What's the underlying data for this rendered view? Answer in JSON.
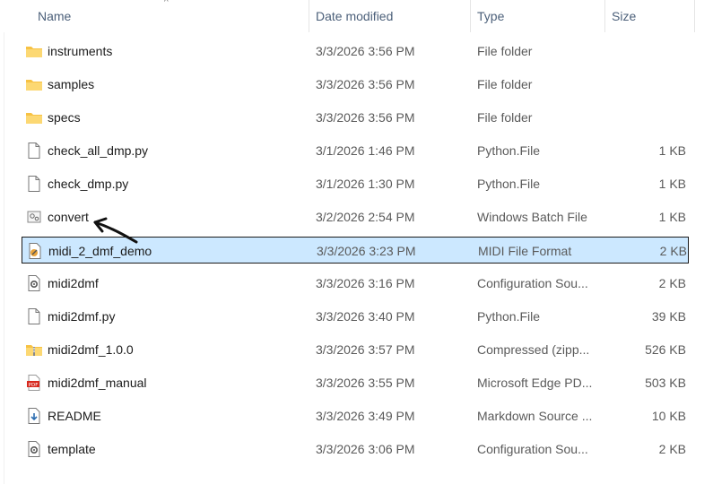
{
  "columns": {
    "name": "Name",
    "date_modified": "Date modified",
    "type": "Type",
    "size": "Size"
  },
  "files": [
    {
      "name": "instruments",
      "date": "3/3/2026 3:56 PM",
      "type": "File folder",
      "size": "",
      "icon": "folder-icon"
    },
    {
      "name": "samples",
      "date": "3/3/2026 3:56 PM",
      "type": "File folder",
      "size": "",
      "icon": "folder-icon"
    },
    {
      "name": "specs",
      "date": "3/3/2026 3:56 PM",
      "type": "File folder",
      "size": "",
      "icon": "folder-icon"
    },
    {
      "name": "check_all_dmp.py",
      "date": "3/1/2026 1:46 PM",
      "type": "Python.File",
      "size": "1 KB",
      "icon": "document-icon"
    },
    {
      "name": "check_dmp.py",
      "date": "3/1/2026 1:30 PM",
      "type": "Python.File",
      "size": "1 KB",
      "icon": "document-icon"
    },
    {
      "name": "convert",
      "date": "3/2/2026 2:54 PM",
      "type": "Windows Batch File",
      "size": "1 KB",
      "icon": "batch-file-icon"
    },
    {
      "name": "midi_2_dmf_demo",
      "date": "3/3/2026 3:23 PM",
      "type": "MIDI File Format",
      "size": "2 KB",
      "icon": "midi-file-icon",
      "selected": true
    },
    {
      "name": "midi2dmf",
      "date": "3/3/2026 3:16 PM",
      "type": "Configuration Sou...",
      "size": "2 KB",
      "icon": "config-file-icon"
    },
    {
      "name": "midi2dmf.py",
      "date": "3/3/2026 3:40 PM",
      "type": "Python.File",
      "size": "39 KB",
      "icon": "document-icon"
    },
    {
      "name": "midi2dmf_1.0.0",
      "date": "3/3/2026 3:57 PM",
      "type": "Compressed (zipp...",
      "size": "526 KB",
      "icon": "zip-folder-icon"
    },
    {
      "name": "midi2dmf_manual",
      "date": "3/3/2026 3:55 PM",
      "type": "Microsoft Edge PD...",
      "size": "503 KB",
      "icon": "pdf-icon"
    },
    {
      "name": "README",
      "date": "3/3/2026 3:49 PM",
      "type": "Markdown Source ...",
      "size": "10 KB",
      "icon": "markdown-file-icon"
    },
    {
      "name": "template",
      "date": "3/3/2026 3:06 PM",
      "type": "Configuration Sou...",
      "size": "2 KB",
      "icon": "config-file-icon"
    }
  ],
  "annotation": {
    "icon": "hand-drawn-arrow-icon",
    "points_to": "convert"
  },
  "colors": {
    "selection": "#cce8ff",
    "folder": "#f7c244",
    "header_text": "#4c607a"
  }
}
